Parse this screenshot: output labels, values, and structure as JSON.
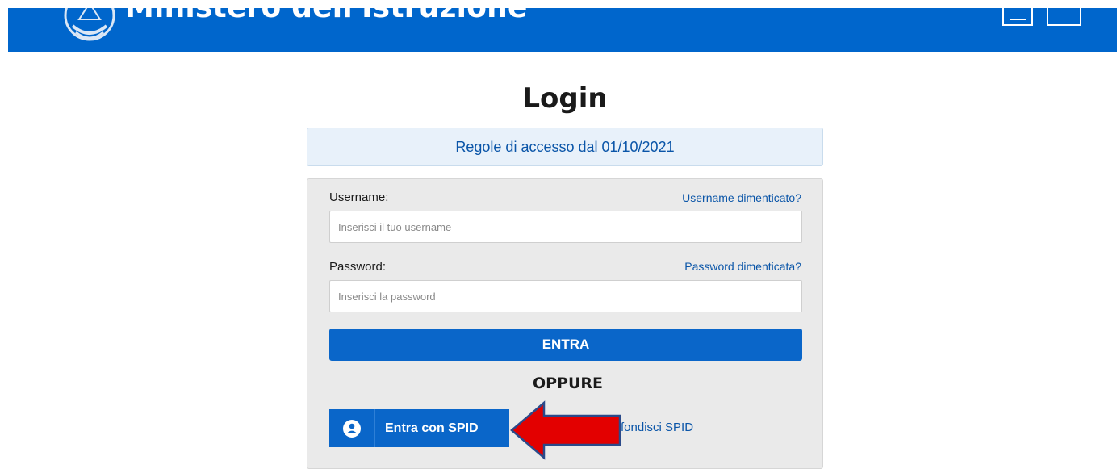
{
  "header": {
    "ministry_name": "Ministero dell'Istruzione",
    "background_color": "#0066cc"
  },
  "login": {
    "title": "Login",
    "access_rules_link": "Regole di accesso dal 01/10/2021",
    "username_label": "Username:",
    "username_forgot_link": "Username dimenticato?",
    "username_placeholder": "Inserisci il tuo username",
    "password_label": "Password:",
    "password_forgot_link": "Password dimenticata?",
    "password_placeholder": "Inserisci la password",
    "submit_label": "ENTRA",
    "divider_text": "OPPURE",
    "spid_button_label": "Entra con SPID",
    "spid_info_link": "fondisci SPID"
  },
  "annotation": {
    "arrow_color": "#e00000",
    "arrow_direction": "left"
  },
  "colors": {
    "primary": "#0a66c9",
    "link": "#0a55a8"
  }
}
